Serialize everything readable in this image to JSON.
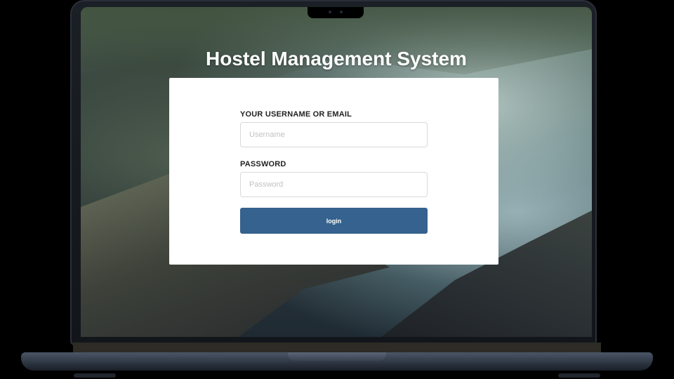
{
  "app": {
    "title": "Hostel Management System"
  },
  "login_form": {
    "username_label": "YOUR USERNAME OR EMAIL",
    "username_placeholder": "Username",
    "username_value": "",
    "password_label": "PASSWORD",
    "password_placeholder": "Password",
    "password_value": "",
    "submit_label": "login"
  },
  "colors": {
    "button_primary": "#35628e",
    "card_background": "#ffffff",
    "title_text": "#ffffff"
  }
}
